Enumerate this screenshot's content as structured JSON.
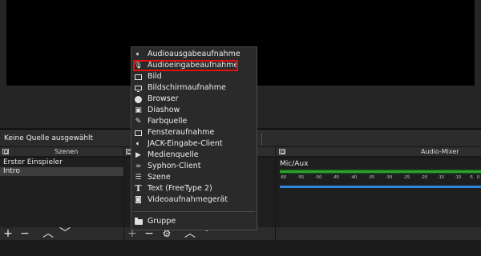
{
  "status": {
    "text": "Keine Quelle ausgewählt"
  },
  "scenes_dock": {
    "title": "Szenen",
    "items": [
      "Erster Einspieler",
      "Intro"
    ],
    "selected_index": 1,
    "toolbar": {
      "add": "+",
      "remove": "−",
      "up": "︿",
      "down": "﹀"
    }
  },
  "sources_toolbar": {
    "add": "+",
    "remove": "−",
    "settings": "⚙",
    "up": "︿",
    "down": "﹀"
  },
  "audio_mixer": {
    "title": "Audio-Mixer",
    "channel": "Mic/Aux",
    "scale": [
      "-60",
      "-55",
      "-50",
      "-45",
      "-40",
      "-35",
      "-30",
      "-25",
      "-20",
      "-15",
      "-10",
      "-5",
      "0"
    ]
  },
  "menu": {
    "items": [
      {
        "label": "Audioausgabeaufnahme",
        "icon": "speaker-icon"
      },
      {
        "label": "Audioeingabeaufnahme",
        "icon": "microphone-icon",
        "highlighted": true
      },
      {
        "label": "Bild",
        "icon": "image-icon"
      },
      {
        "label": "Bildschirmaufnahme",
        "icon": "monitor-icon"
      },
      {
        "label": "Browser",
        "icon": "globe-icon"
      },
      {
        "label": "Diashow",
        "icon": "slideshow-icon"
      },
      {
        "label": "Farbquelle",
        "icon": "brush-icon"
      },
      {
        "label": "Fensteraufnahme",
        "icon": "window-icon"
      },
      {
        "label": "JACK-Eingabe-Client",
        "icon": "speaker-icon"
      },
      {
        "label": "Medienquelle",
        "icon": "play-icon"
      },
      {
        "label": "Syphon-Client",
        "icon": "syphon-icon"
      },
      {
        "label": "Szene",
        "icon": "list-icon"
      },
      {
        "label": "Text (FreeType 2)",
        "icon": "text-icon"
      },
      {
        "label": "Videoaufnahmegerät",
        "icon": "camera-icon"
      },
      {
        "label": "Gruppe",
        "icon": "folder-icon"
      }
    ]
  },
  "colors": {
    "highlight": "#e01010",
    "meter": "#2aa52a",
    "fader": "#2e86de"
  }
}
